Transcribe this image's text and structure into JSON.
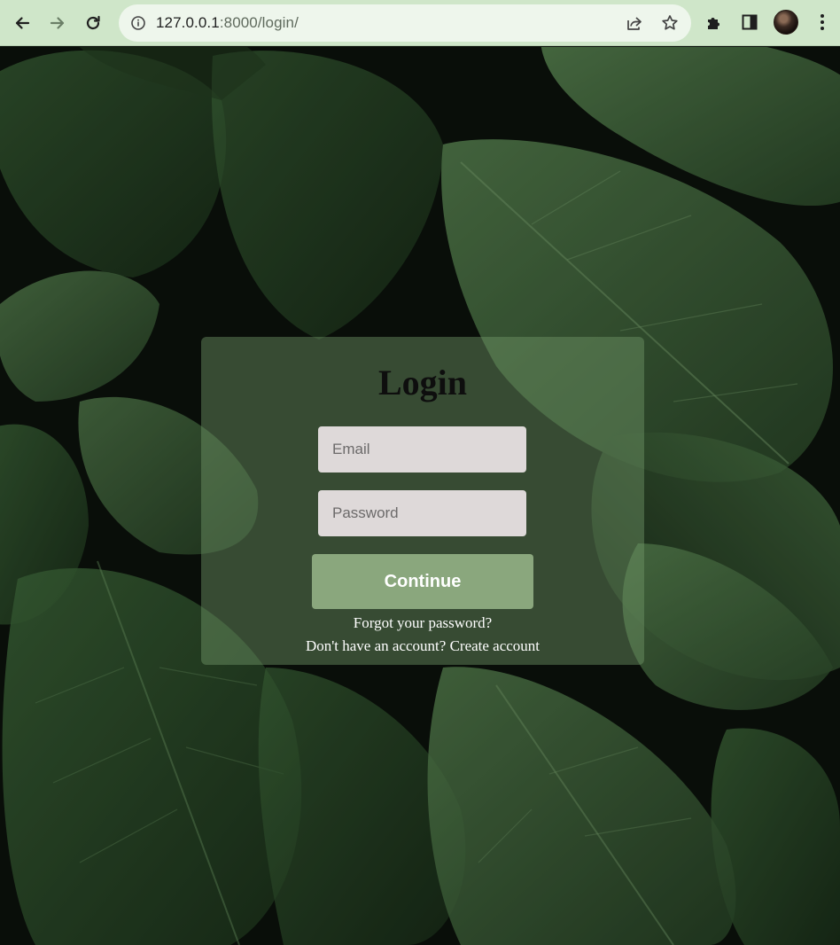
{
  "browser": {
    "url_host": "127.0.0.1",
    "url_rest": ":8000/login/"
  },
  "login": {
    "title": "Login",
    "email_placeholder": "Email",
    "password_placeholder": "Password",
    "submit_label": "Continue",
    "forgot_password": "Forgot your password?",
    "no_account_prompt": "Don't have an account?",
    "create_account": "Create account"
  }
}
